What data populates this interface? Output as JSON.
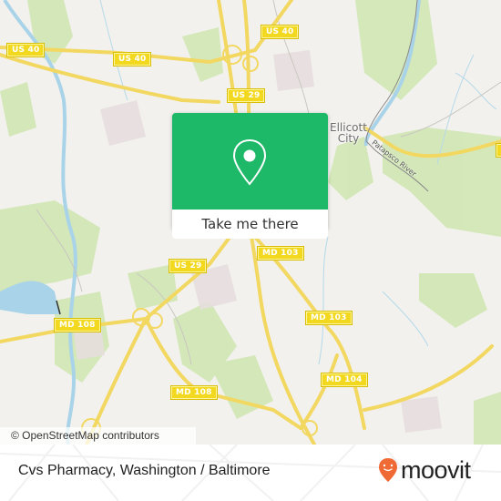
{
  "map": {
    "road_shields": [
      {
        "label": "US 40"
      },
      {
        "label": "US 40"
      },
      {
        "label": "US 40"
      },
      {
        "label": "US 29"
      },
      {
        "label": "US 29"
      },
      {
        "label": "MD 103"
      },
      {
        "label": "MD 103"
      },
      {
        "label": "MD 108"
      },
      {
        "label": "MD 108"
      },
      {
        "label": "MD 104"
      }
    ],
    "places": [
      {
        "label": "Ellicott\nCity",
        "line1": "Ellicott",
        "line2": "City"
      }
    ],
    "river_label": "Patapsco River",
    "attribution": "© OpenStreetMap contributors"
  },
  "popup": {
    "icon": "map-pin-icon",
    "button_label": "Take me there",
    "color": "#1db868"
  },
  "footer": {
    "title": "Cvs Pharmacy, Washington / Baltimore",
    "logo_text": "moovit",
    "logo_color": "#f06a35"
  }
}
